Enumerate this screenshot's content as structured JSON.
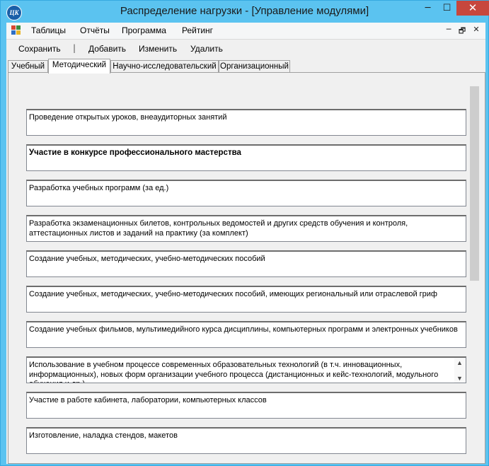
{
  "window": {
    "title": "Распределение нагрузки - [Управление модулями]",
    "app_icon_text": "ЦК",
    "minimize_glyph": "─",
    "maximize_glyph": "☐",
    "close_glyph": "✕"
  },
  "menu": {
    "items": [
      "Таблицы",
      "Отчёты",
      "Программа",
      "Рейтинг"
    ],
    "mdi": {
      "minimize": "─",
      "restore": "🗗",
      "close": "✕"
    }
  },
  "toolbar": {
    "save": "Сохранить",
    "separator": "|",
    "add": "Добавить",
    "edit": "Изменить",
    "delete": "Удалить"
  },
  "tabs": [
    "Учебный",
    "Методический",
    "Научно-исследовательский",
    "Организационный"
  ],
  "active_tab": "Методический",
  "fields": [
    "Проведение открытых уроков, внеаудиторных занятий",
    "Участие в конкурсе профессионального мастерства",
    "Разработка учебных программ (за ед.)",
    "Разработка  экзаменационных билетов, контрольных ведомостей и других средств обучения и контроля, аттестационных листов и заданий на практику (за комплект)",
    "Создание учебных, методических, учебно-методических пособий",
    "Создание учебных, методических, учебно-методических пособий, имеющих региональный или отраслевой гриф",
    "Создание учебных фильмов, мультимедийного курса дисциплины, компьютерных программ и электронных учебников",
    "Использование в учебном процессе современных образовательных технологий (в т.ч.  инновационных, информационных), новых форм организации учебного процесса (дистанционных и кейс-технологий, модульного обучения и др.)",
    "Участие в работе кабинета, лаборатории, компьютерных классов",
    "Изготовление, наладка стендов, макетов"
  ],
  "colors": {
    "title_bar": "#5bc3f0",
    "close_button": "#c7473d",
    "client_bg": "#f0f0f0"
  }
}
